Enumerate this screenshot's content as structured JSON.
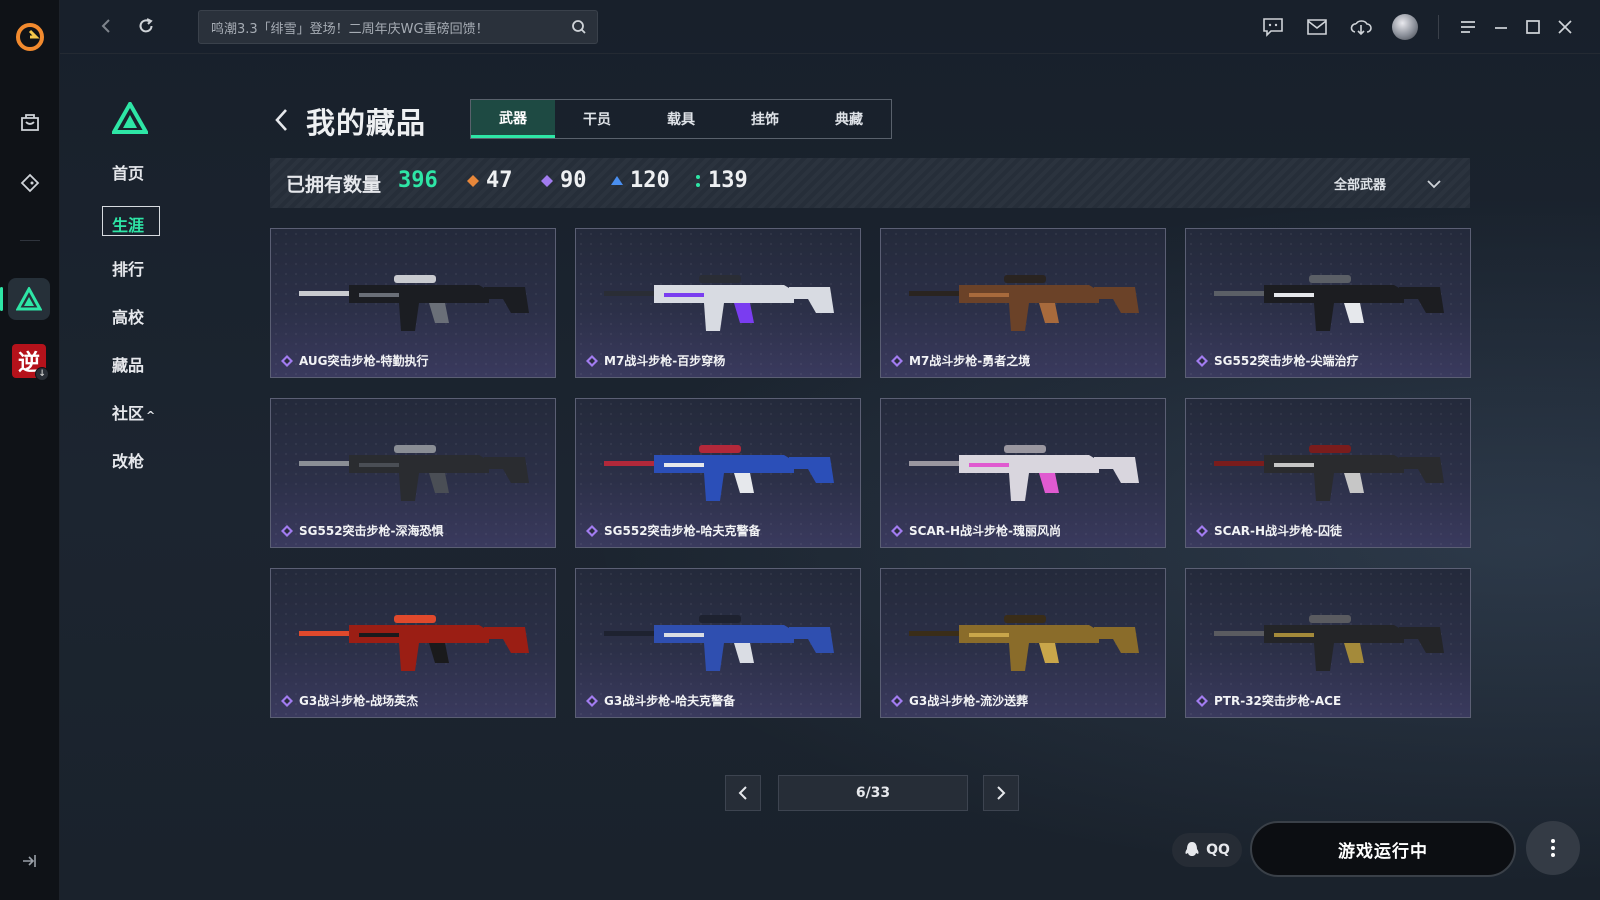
{
  "topbar": {
    "search_value": "鸣潮3.3「绯雪」登场！二周年庆WG重磅回馈！"
  },
  "icons": {
    "app_logo": "brand-logo-icon",
    "rail": [
      "store-bag-icon",
      "game-controller-icon"
    ],
    "top": [
      "chat-bubble-icon",
      "mail-icon",
      "download-icon",
      "menu-icon",
      "minimize-icon",
      "maximize-icon",
      "close-icon"
    ]
  },
  "subnav": {
    "items": [
      {
        "label": "首页"
      },
      {
        "label": "生涯"
      },
      {
        "label": "排行"
      },
      {
        "label": "高校"
      },
      {
        "label": "藏品"
      },
      {
        "label": "社区"
      },
      {
        "label": "改枪"
      }
    ],
    "community_caret": "^"
  },
  "page": {
    "title": "我的藏品"
  },
  "tabs": [
    {
      "label": "武器"
    },
    {
      "label": "干员"
    },
    {
      "label": "载具"
    },
    {
      "label": "挂饰"
    },
    {
      "label": "典藏"
    }
  ],
  "stats": {
    "owned_label": "已拥有数量",
    "owned_count": "396",
    "tiers": [
      {
        "value": "47",
        "color": "#e8873a"
      },
      {
        "value": "90",
        "color": "#a27cf0"
      },
      {
        "value": "120",
        "color": "#4a8ff0"
      },
      {
        "value": "139",
        "color": "#2ee6a6"
      }
    ],
    "filter_label": "全部武器"
  },
  "items": [
    {
      "name": "AUG突击步枪-特勤执行"
    },
    {
      "name": "M7战斗步枪-百步穿杨"
    },
    {
      "name": "M7战斗步枪-勇者之境"
    },
    {
      "name": "SG552突击步枪-尖端治疗"
    },
    {
      "name": "SG552突击步枪-深海恐惧"
    },
    {
      "name": "SG552突击步枪-哈夫克警备"
    },
    {
      "name": "SCAR-H战斗步枪-瑰丽风尚"
    },
    {
      "name": "SCAR-H战斗步枪-囚徒"
    },
    {
      "name": "G3战斗步枪-战场英杰"
    },
    {
      "name": "G3战斗步枪-哈夫克警备"
    },
    {
      "name": "G3战斗步枪-流沙送葬"
    },
    {
      "name": "PTR-32突击步枪-ACE"
    }
  ],
  "pagination": {
    "display": "6/33"
  },
  "bottom": {
    "qq_label": "QQ",
    "run_label": "游戏运行中"
  },
  "colors": {
    "accent": "#2ee6a6",
    "rarity_purple": "#a27cf0"
  }
}
